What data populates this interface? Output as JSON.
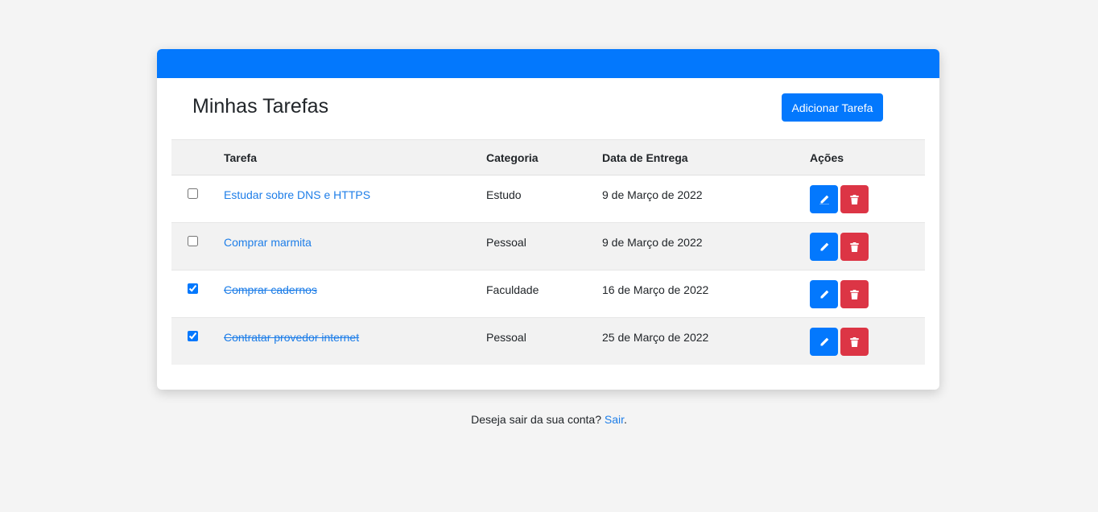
{
  "header": {
    "title": "Minhas Tarefas",
    "add_button_label": "Adicionar Tarefa"
  },
  "table": {
    "columns": [
      "",
      "Tarefa",
      "Categoria",
      "Data de Entrega",
      "Ações"
    ],
    "rows": [
      {
        "done": false,
        "task": "Estudar sobre DNS e HTTPS",
        "category": "Estudo",
        "date": "9 de Março de 2022"
      },
      {
        "done": false,
        "task": "Comprar marmita",
        "category": "Pessoal",
        "date": "9 de Março de 2022"
      },
      {
        "done": true,
        "task": "Comprar cadernos",
        "category": "Faculdade",
        "date": "16 de Março de 2022"
      },
      {
        "done": true,
        "task": "Contratar provedor internet",
        "category": "Pessoal",
        "date": "25 de Março de 2022"
      }
    ],
    "edit_icon": "pencil-icon",
    "delete_icon": "trash-icon"
  },
  "footer": {
    "question": "Deseja sair da sua conta? ",
    "logout_link": "Sair",
    "period": "."
  },
  "colors": {
    "primary": "#0378fd",
    "danger": "#dc3545",
    "link": "#1e7ee8",
    "background": "#f4f4f4"
  }
}
